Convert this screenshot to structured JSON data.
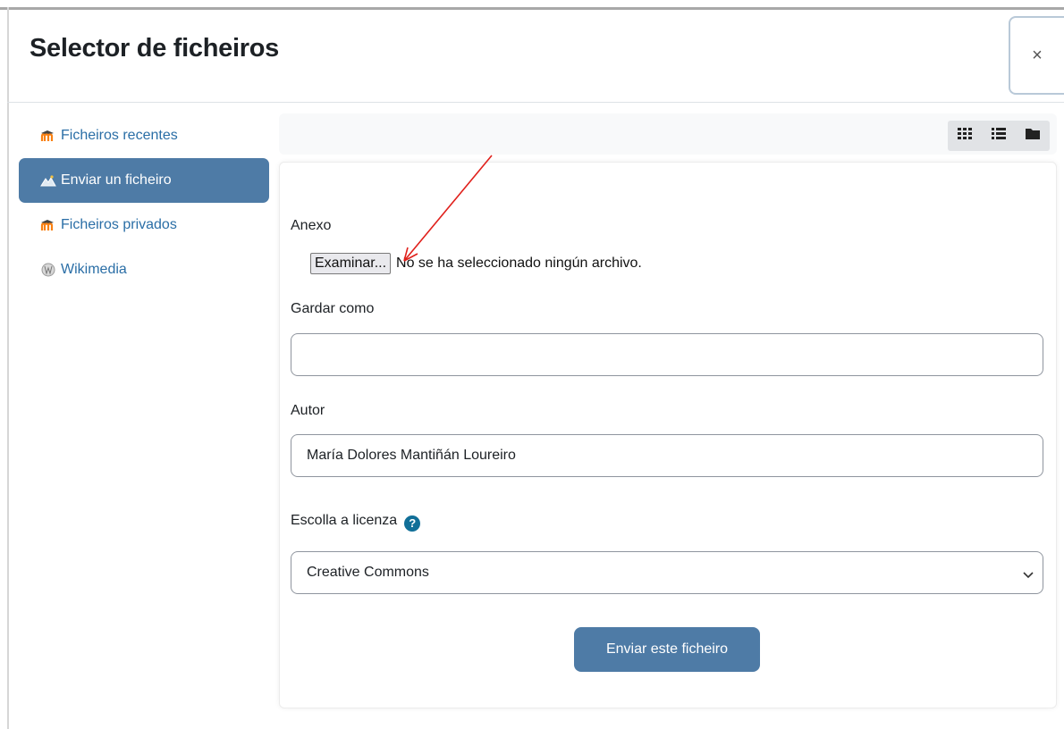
{
  "dialog": {
    "title": "Selector de ficheiros",
    "close_label": "×"
  },
  "sidebar": {
    "items": [
      {
        "label": "Ficheiros recentes",
        "icon": "moodle-icon",
        "active": false
      },
      {
        "label": "Enviar un ficheiro",
        "icon": "upload-icon",
        "active": true
      },
      {
        "label": "Ficheiros privados",
        "icon": "moodle-icon",
        "active": false
      },
      {
        "label": "Wikimedia",
        "icon": "wikimedia-icon",
        "active": false
      }
    ]
  },
  "toolbar": {
    "views": [
      "grid-view-icon",
      "list-view-icon",
      "folder-view-icon"
    ]
  },
  "form": {
    "attachment_label": "Anexo",
    "browse_label": "Examinar...",
    "file_status": "No se ha seleccionado ningún archivo.",
    "save_as_label": "Gardar como",
    "save_as_value": "",
    "author_label": "Autor",
    "author_value": "María Dolores Mantiñán Loureiro",
    "license_label": "Escolla a licenza",
    "license_value": "Creative Commons",
    "submit_label": "Enviar este ficheiro"
  },
  "colors": {
    "accent": "#4e7ba6",
    "link": "#2a6ea6",
    "help": "#116f98",
    "annotation_arrow": "#e0201b"
  }
}
